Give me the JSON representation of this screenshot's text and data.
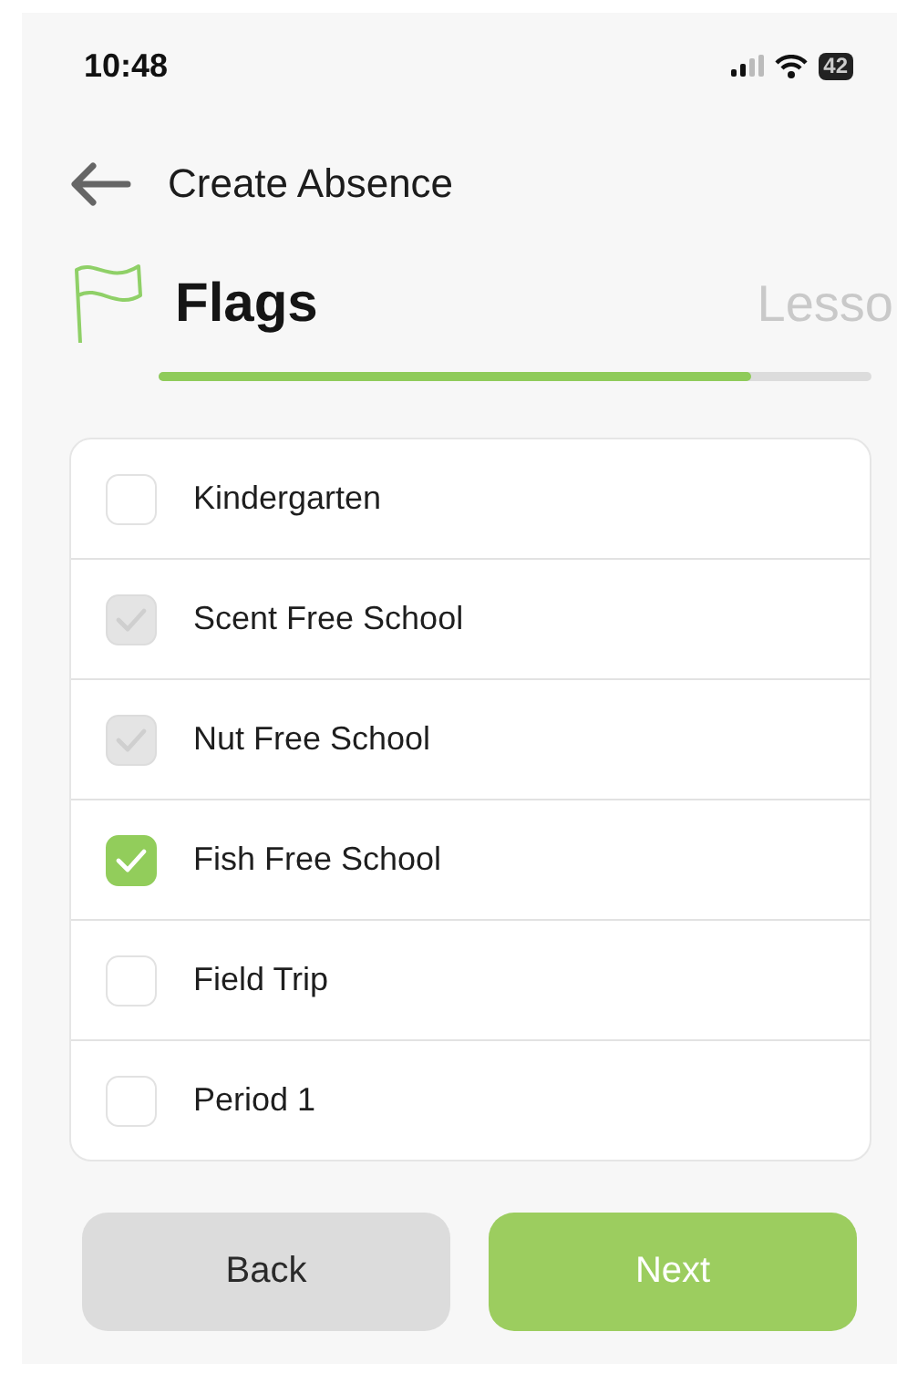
{
  "status_bar": {
    "time": "10:48",
    "battery": "42"
  },
  "header": {
    "title": "Create Absence"
  },
  "steps": [
    {
      "label": "Flags",
      "selected": true
    },
    {
      "label": "Lesso",
      "selected": false
    }
  ],
  "progress": {
    "level": 0.83
  },
  "flags": [
    {
      "label": "Kindergarten",
      "checked": false,
      "disabled": false
    },
    {
      "label": "Scent Free School",
      "checked": true,
      "disabled": true
    },
    {
      "label": "Nut Free School",
      "checked": true,
      "disabled": true
    },
    {
      "label": "Fish Free School",
      "checked": true,
      "disabled": false
    },
    {
      "label": "Field Trip",
      "checked": false,
      "disabled": false
    },
    {
      "label": "Period 1",
      "checked": false,
      "disabled": false
    }
  ],
  "buttons": [
    {
      "label": "Back",
      "kind": "secondary"
    },
    {
      "label": "Next",
      "kind": "primary"
    }
  ]
}
